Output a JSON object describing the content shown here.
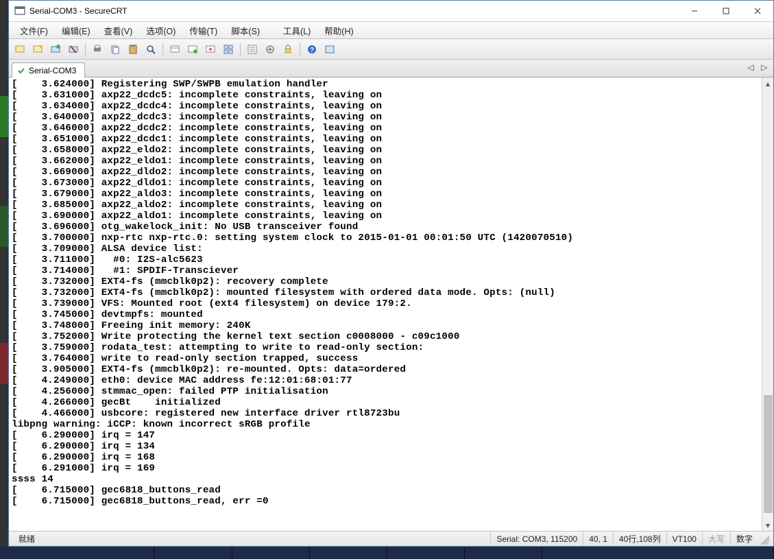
{
  "window": {
    "title": "Serial-COM3 - SecureCRT"
  },
  "menu": {
    "items": [
      "文件(F)",
      "编辑(E)",
      "查看(V)",
      "选项(O)",
      "传输(T)",
      "脚本(S)",
      "工具(L)",
      "帮助(H)"
    ]
  },
  "toolbar": {
    "icons": [
      "connect-icon",
      "quick-connect-icon",
      "reconnect-icon",
      "disconnect-icon",
      "sep",
      "print-icon",
      "copy-icon",
      "paste-icon",
      "find-icon",
      "sep",
      "sessions-icon",
      "properties-icon",
      "new-session-icon",
      "tile-icon",
      "sep",
      "options-icon",
      "script-icon",
      "lock-icon",
      "sep",
      "help-icon",
      "about-icon"
    ]
  },
  "tab": {
    "label": "Serial-COM3",
    "connected": true
  },
  "terminal_lines": [
    "[    3.624000] Registering SWP/SWPB emulation handler",
    "[    3.631000] axp22_dcdc5: incomplete constraints, leaving on",
    "[    3.634000] axp22_dcdc4: incomplete constraints, leaving on",
    "[    3.640000] axp22_dcdc3: incomplete constraints, leaving on",
    "[    3.646000] axp22_dcdc2: incomplete constraints, leaving on",
    "[    3.651000] axp22_dcdc1: incomplete constraints, leaving on",
    "[    3.658000] axp22_eldo2: incomplete constraints, leaving on",
    "[    3.662000] axp22_eldo1: incomplete constraints, leaving on",
    "[    3.669000] axp22_dldo2: incomplete constraints, leaving on",
    "[    3.673000] axp22_dldo1: incomplete constraints, leaving on",
    "[    3.679000] axp22_aldo3: incomplete constraints, leaving on",
    "[    3.685000] axp22_aldo2: incomplete constraints, leaving on",
    "[    3.690000] axp22_aldo1: incomplete constraints, leaving on",
    "[    3.696000] otg_wakelock_init: No USB transceiver found",
    "[    3.700000] nxp-rtc nxp-rtc.0: setting system clock to 2015-01-01 00:01:50 UTC (1420070510)",
    "[    3.709000] ALSA device list:",
    "[    3.711000]   #0: I2S-alc5623",
    "[    3.714000]   #1: SPDIF-Transciever",
    "[    3.732000] EXT4-fs (mmcblk0p2): recovery complete",
    "[    3.732000] EXT4-fs (mmcblk0p2): mounted filesystem with ordered data mode. Opts: (null)",
    "[    3.739000] VFS: Mounted root (ext4 filesystem) on device 179:2.",
    "[    3.745000] devtmpfs: mounted",
    "[    3.748000] Freeing init memory: 240K",
    "[    3.752000] Write protecting the kernel text section c0008000 - c09c1000",
    "[    3.759000] rodata_test: attempting to write to read-only section:",
    "[    3.764000] write to read-only section trapped, success",
    "[    3.905000] EXT4-fs (mmcblk0p2): re-mounted. Opts: data=ordered",
    "[    4.249000] eth0: device MAC address fe:12:01:68:01:77",
    "[    4.256000] stmmac_open: failed PTP initialisation",
    "[    4.266000] gecBt    initialized",
    "[    4.466000] usbcore: registered new interface driver rtl8723bu",
    "libpng warning: iCCP: known incorrect sRGB profile",
    "[    6.290000] irq = 147",
    "[    6.290000] irq = 134",
    "[    6.290000] irq = 168",
    "[    6.291000] irq = 169",
    "ssss 14",
    "[    6.715000] gec6818_buttons_read",
    "[    6.715000] gec6818_buttons_read, err =0"
  ],
  "status": {
    "ready": "就绪",
    "conn": "Serial: COM3, 115200",
    "cursor": "40,  1",
    "size": "40行,108列",
    "emu": "VT100",
    "caps": "大写",
    "num": "数字"
  }
}
